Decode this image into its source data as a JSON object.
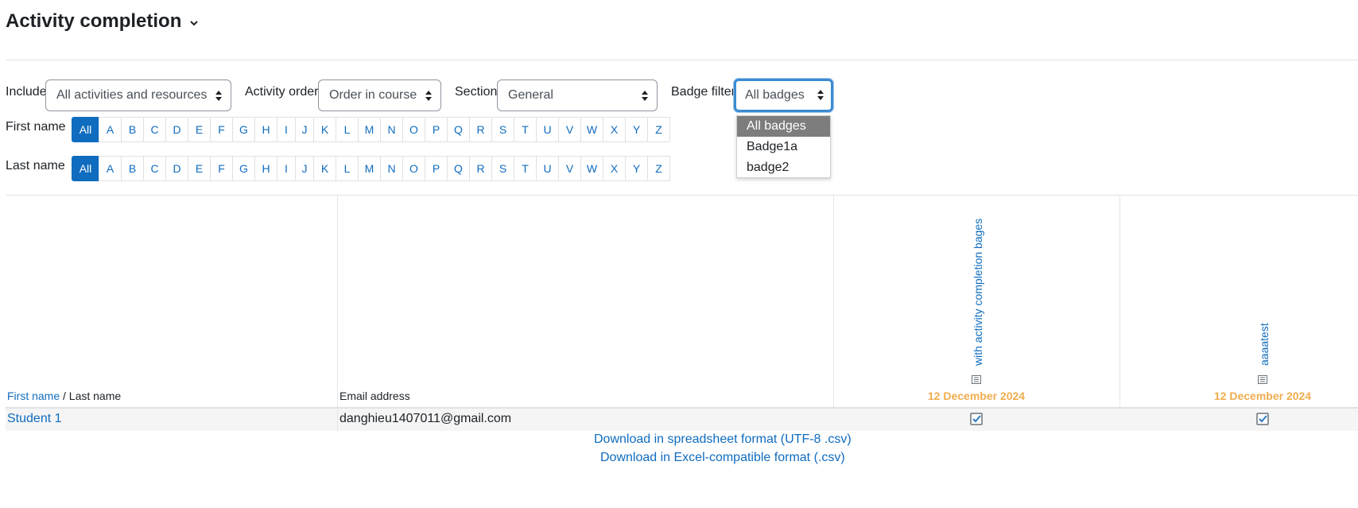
{
  "page": {
    "title": "Activity completion"
  },
  "filters": {
    "include_label": "Include",
    "include_value": "All activities and resources",
    "order_label": "Activity order",
    "order_value": "Order in course",
    "section_label": "Section",
    "section_value": "General",
    "badge_label": "Badge filter",
    "badge_value": "All badges",
    "badge_options": [
      "All badges",
      "Badge1a",
      "badge2"
    ]
  },
  "initials": {
    "first_label": "First name",
    "last_label": "Last name",
    "letters": [
      "All",
      "A",
      "B",
      "C",
      "D",
      "E",
      "F",
      "G",
      "H",
      "I",
      "J",
      "K",
      "L",
      "M",
      "N",
      "O",
      "P",
      "Q",
      "R",
      "S",
      "T",
      "U",
      "V",
      "W",
      "X",
      "Y",
      "Z"
    ]
  },
  "table": {
    "header_firstname": "First name",
    "header_separator": " / ",
    "header_lastname": "Last name",
    "header_email": "Email address",
    "activities": [
      {
        "name": "with activity completion bages",
        "date": "12 December 2024"
      },
      {
        "name": "aaaatest",
        "date": "12 December 2024"
      }
    ],
    "rows": [
      {
        "name": "Student 1",
        "email": "danghieu1407011@gmail.com"
      }
    ]
  },
  "downloads": {
    "csv_utf8": "Download in spreadsheet format (UTF-8 .csv)",
    "csv_excel": "Download in Excel-compatible format (.csv)"
  },
  "colors": {
    "link": "#0f6cbf",
    "date": "#f0ad4e",
    "focus": "#3b8bd1"
  }
}
